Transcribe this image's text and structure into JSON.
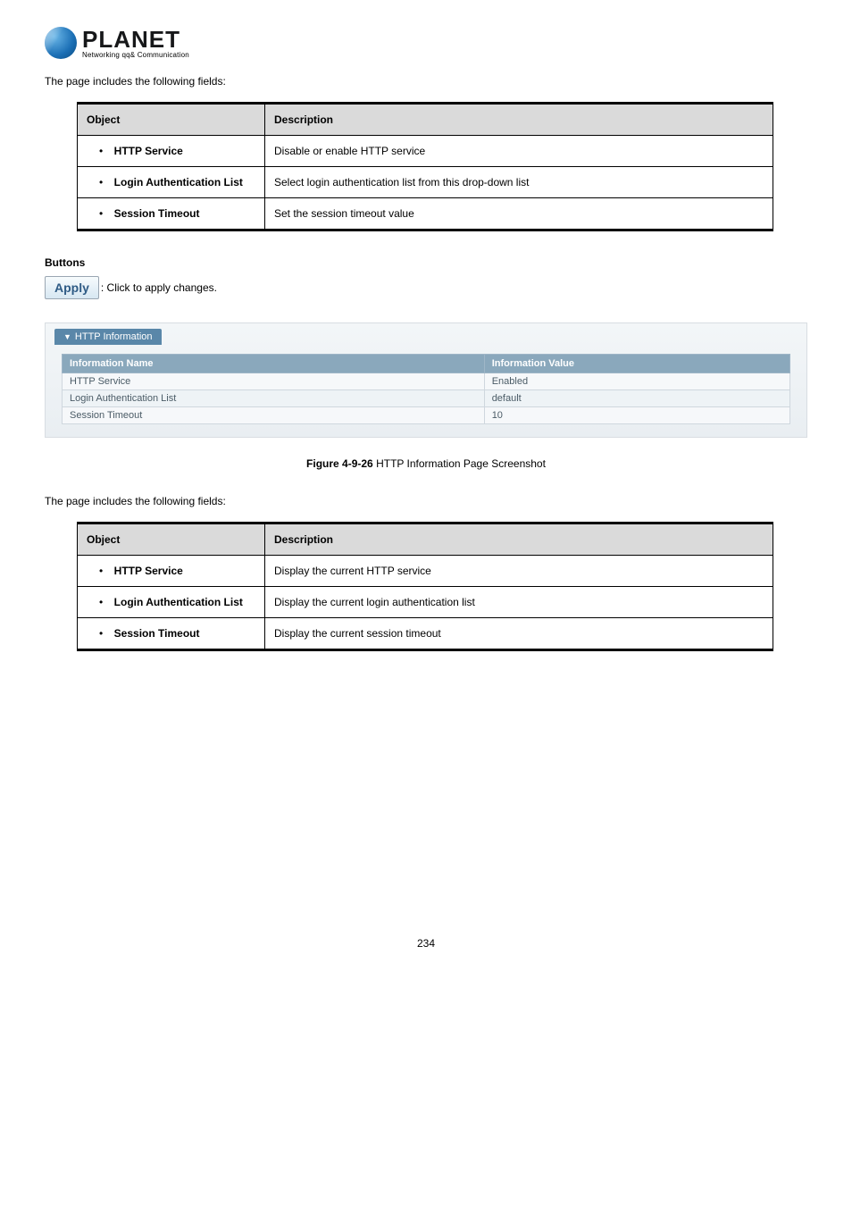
{
  "logo": {
    "word": "PLANET",
    "sub": "Networking qq& Communication"
  },
  "intro1": "The page includes the following fields:",
  "table1": {
    "headers": {
      "object": "Object",
      "description": "Description"
    },
    "rows": [
      {
        "obj": "HTTP Service",
        "desc": "Disable or enable HTTP service"
      },
      {
        "obj": "Login Authentication List",
        "desc": "Select login authentication list from this drop-down list"
      },
      {
        "obj": "Session Timeout",
        "desc": "Set the session timeout value"
      }
    ]
  },
  "buttons": {
    "heading": "Buttons",
    "apply_label": "Apply",
    "apply_text": ": Click to apply changes."
  },
  "panel": {
    "title": "HTTP Information",
    "headers": {
      "name": "Information Name",
      "value": "Information Value"
    },
    "rows": [
      {
        "name": "HTTP Service",
        "value": "Enabled"
      },
      {
        "name": "Login Authentication List",
        "value": "default"
      },
      {
        "name": "Session Timeout",
        "value": "10"
      }
    ]
  },
  "figure": {
    "label": "Figure 4-9-26",
    "caption": " HTTP Information Page Screenshot"
  },
  "intro2": "The page includes the following fields:",
  "table2": {
    "headers": {
      "object": "Object",
      "description": "Description"
    },
    "rows": [
      {
        "obj": "HTTP Service",
        "desc": "Display the current HTTP service"
      },
      {
        "obj": "Login Authentication List",
        "desc": "Display the current login authentication list"
      },
      {
        "obj": "Session Timeout",
        "desc": "Display the current session timeout"
      }
    ]
  },
  "page_number": "234"
}
